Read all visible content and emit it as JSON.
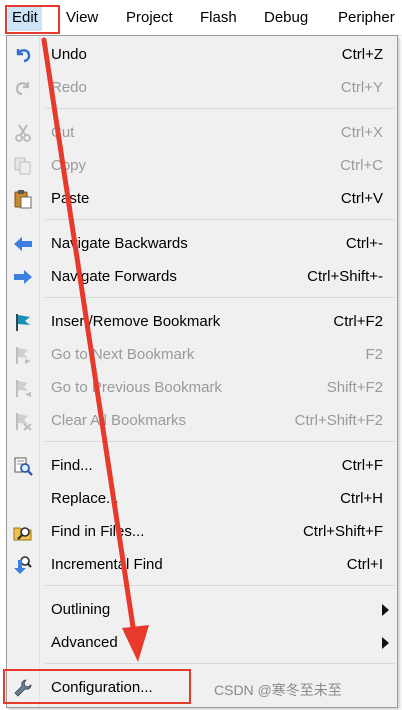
{
  "menubar": {
    "items": [
      {
        "label": "Edit",
        "active": true
      },
      {
        "label": "View"
      },
      {
        "label": "Project"
      },
      {
        "label": "Flash"
      },
      {
        "label": "Debug"
      },
      {
        "label": "Peripher"
      }
    ]
  },
  "menu": {
    "items": [
      {
        "label": "Undo",
        "shortcut": "Ctrl+Z",
        "enabled": true,
        "icon": "undo-icon"
      },
      {
        "label": "Redo",
        "shortcut": "Ctrl+Y",
        "enabled": false,
        "icon": "redo-icon"
      },
      {
        "label": "Cut",
        "shortcut": "Ctrl+X",
        "enabled": false,
        "icon": "cut-icon"
      },
      {
        "label": "Copy",
        "shortcut": "Ctrl+C",
        "enabled": false,
        "icon": "copy-icon"
      },
      {
        "label": "Paste",
        "shortcut": "Ctrl+V",
        "enabled": true,
        "icon": "paste-icon"
      },
      {
        "label": "Navigate Backwards",
        "shortcut": "Ctrl+-",
        "enabled": true,
        "icon": "arrow-left-icon"
      },
      {
        "label": "Navigate Forwards",
        "shortcut": "Ctrl+Shift+-",
        "enabled": true,
        "icon": "arrow-right-icon"
      },
      {
        "label": "Insert/Remove Bookmark",
        "shortcut": "Ctrl+F2",
        "enabled": true,
        "icon": "bookmark-flag-icon"
      },
      {
        "label": "Go to Next Bookmark",
        "shortcut": "F2",
        "enabled": false,
        "icon": "next-bookmark-icon"
      },
      {
        "label": "Go to Previous Bookmark",
        "shortcut": "Shift+F2",
        "enabled": false,
        "icon": "previous-bookmark-icon"
      },
      {
        "label": "Clear All Bookmarks",
        "shortcut": "Ctrl+Shift+F2",
        "enabled": false,
        "icon": "clear-bookmarks-icon"
      },
      {
        "label": "Find...",
        "shortcut": "Ctrl+F",
        "enabled": true,
        "icon": "find-icon"
      },
      {
        "label": "Replace...",
        "shortcut": "Ctrl+H",
        "enabled": true,
        "icon": ""
      },
      {
        "label": "Find in Files...",
        "shortcut": "Ctrl+Shift+F",
        "enabled": true,
        "icon": "find-in-files-icon"
      },
      {
        "label": "Incremental Find",
        "shortcut": "Ctrl+I",
        "enabled": true,
        "icon": "incremental-find-icon"
      },
      {
        "label": "Outlining",
        "shortcut": "",
        "enabled": true,
        "submenu": true
      },
      {
        "label": "Advanced",
        "shortcut": "",
        "enabled": true,
        "submenu": true
      },
      {
        "label": "Configuration...",
        "shortcut": "",
        "enabled": true,
        "icon": "wrench-icon"
      }
    ]
  },
  "watermark": "CSDN @寒冬至未至",
  "colors": {
    "highlight": "#e8392d",
    "menu_bg": "#f0f0f0",
    "disabled_text": "#9a9a9a",
    "active_menubar": "#cce4f7"
  }
}
